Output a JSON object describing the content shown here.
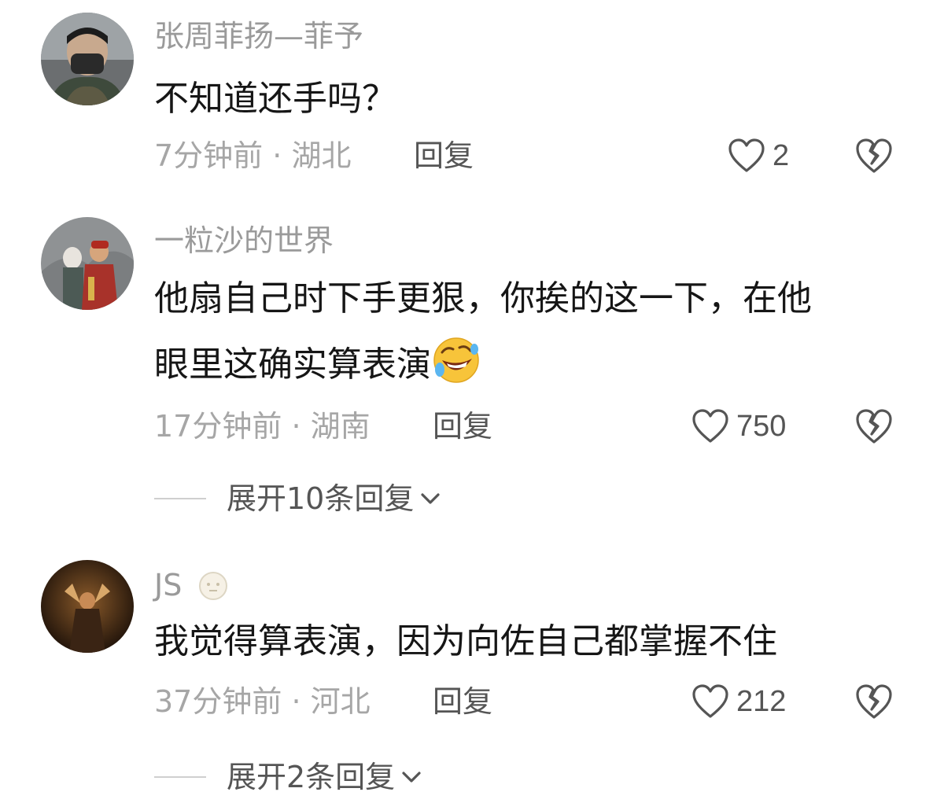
{
  "comments": [
    {
      "username": "张周菲扬—菲予",
      "content_lines": [
        "不知道还手吗？"
      ],
      "time": "7分钟前",
      "separator": "·",
      "location": "湖北",
      "reply_label": "回复",
      "likes": "2",
      "icons": {
        "like": "heart-outline-icon",
        "dislike": "broken-heart-icon"
      }
    },
    {
      "username": "一粒沙的世界",
      "content_lines": [
        "他扇自己时下手更狠，你挨的这一下，在他",
        "眼里这确实算表演"
      ],
      "emoji": "rolling-on-floor-laughing-emoji",
      "time": "17分钟前",
      "separator": "·",
      "location": "湖南",
      "reply_label": "回复",
      "likes": "750",
      "icons": {
        "like": "heart-outline-icon",
        "dislike": "broken-heart-icon"
      },
      "expand_label": "展开10条回复"
    },
    {
      "username": "JS",
      "badge_icon": "smiley-badge-icon",
      "content_lines": [
        "我觉得算表演，因为向佐自己都掌握不住"
      ],
      "time": "37分钟前",
      "separator": "·",
      "location": "河北",
      "reply_label": "回复",
      "likes": "212",
      "icons": {
        "like": "heart-outline-icon",
        "dislike": "broken-heart-icon"
      },
      "expand_label": "展开2条回复"
    }
  ],
  "colors": {
    "username": "#9a9a9a",
    "content": "#161616",
    "meta": "#a6a6a6",
    "action": "#555555",
    "emoji_face": "#f7c43a"
  }
}
